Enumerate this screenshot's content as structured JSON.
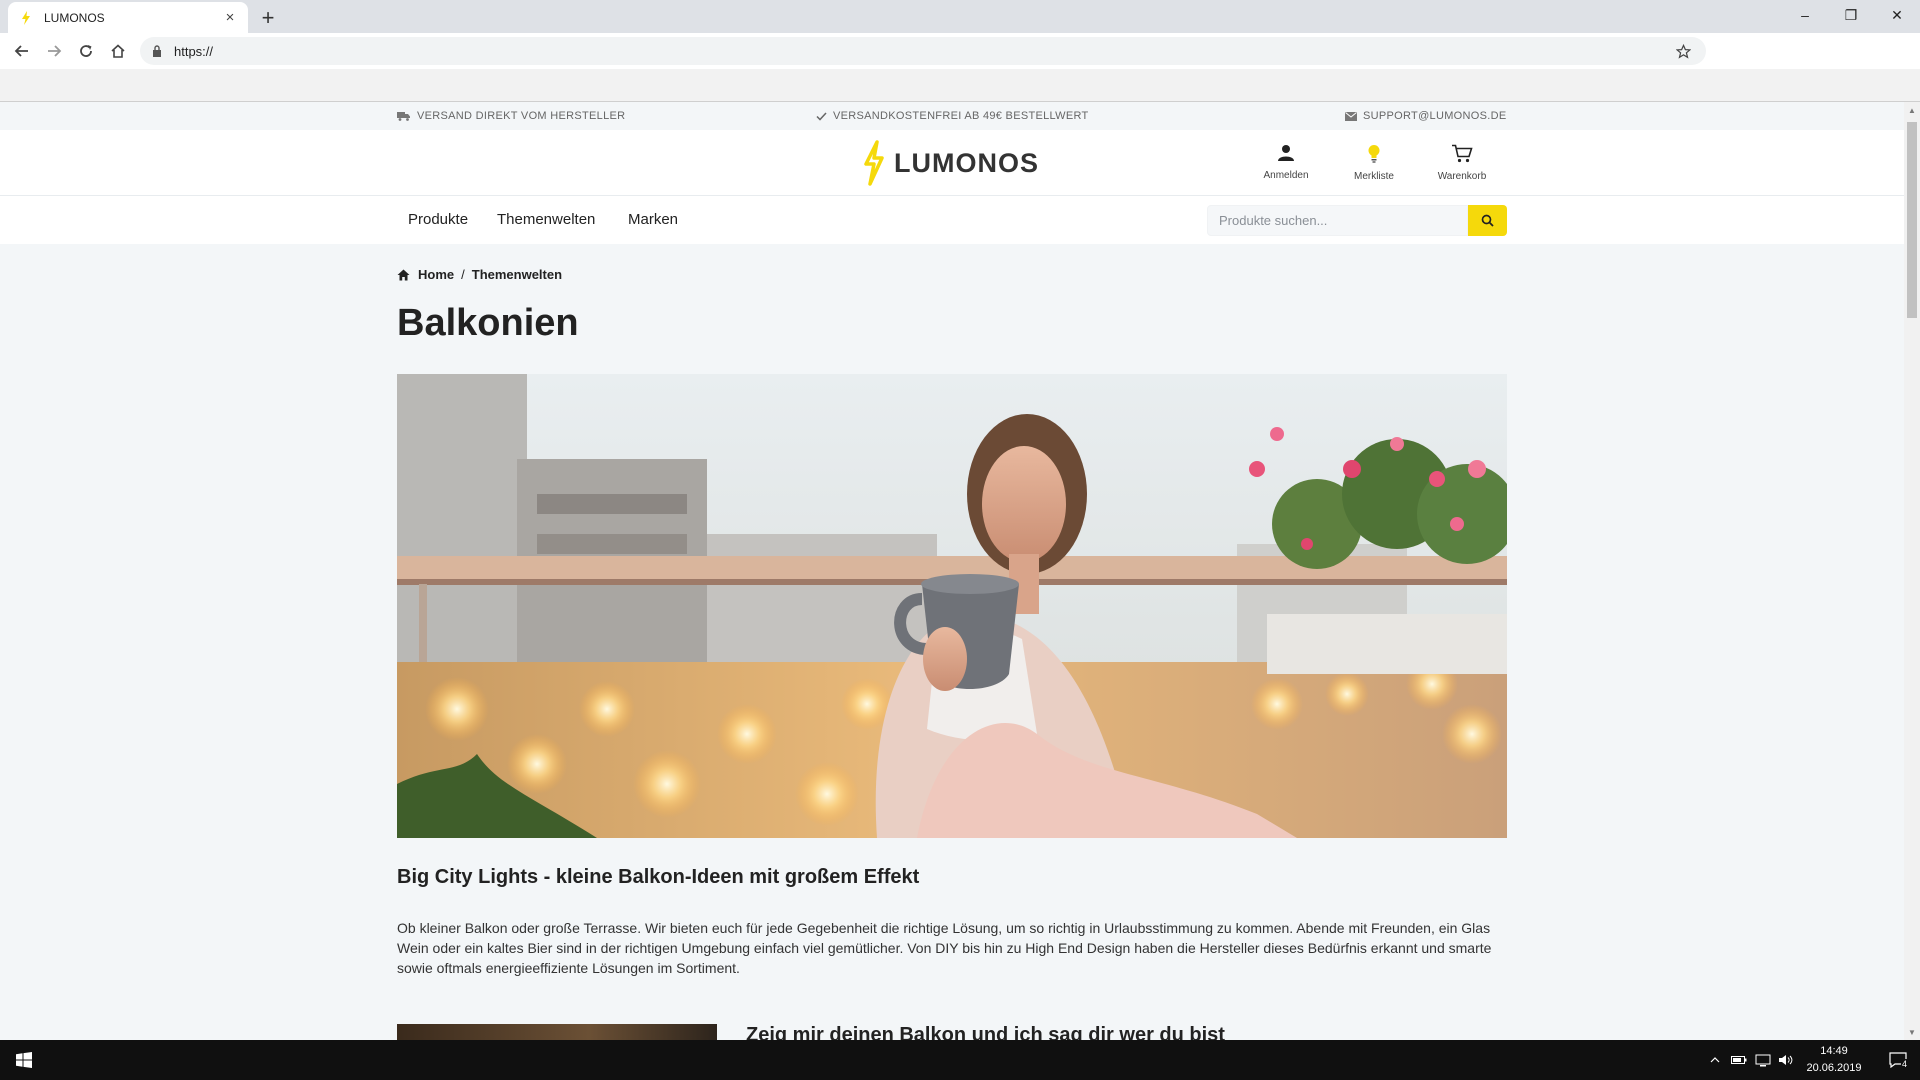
{
  "browser": {
    "tab_title": "LUMONOS",
    "tab_close": "×",
    "new_tab": "+",
    "url": "https://",
    "window_minimize": "–",
    "window_restore": "❐",
    "window_close": "✕"
  },
  "topbar": {
    "shipping": "VERSAND DIREKT VOM HERSTELLER",
    "free_shipping": "VERSANDKOSTENFREI AB 49€ BESTELLWERT",
    "support": "SUPPORT@LUMONOS.DE"
  },
  "header": {
    "logo_text": "LUMONOS",
    "login": "Anmelden",
    "wishlist": "Merkliste",
    "cart": "Warenkorb"
  },
  "nav": {
    "items": [
      "Produkte",
      "Themenwelten",
      "Marken"
    ],
    "search_placeholder": "Produkte suchen..."
  },
  "breadcrumb": {
    "home": "Home",
    "separator": "/",
    "current": "Themenwelten"
  },
  "page": {
    "title": "Balkonien",
    "subtitle": "Big City Lights - kleine Balkon-Ideen mit großem Effekt",
    "lead": "Ob kleiner Balkon oder große Terrasse. Wir bieten euch für jede Gegebenheit die richtige Lösung, um so richtig in Urlaubsstimmung zu kommen. Abende mit Freunden, ein Glas Wein oder ein kaltes Bier sind in der richtigen Umgebung einfach viel gemütlicher. Von DIY bis hin zu High End Design haben die Hersteller dieses Bedürfnis erkannt und smarte sowie oftmals energieeffiziente Lösungen im Sortiment.",
    "teaser_heading": "Zeig mir deinen Balkon und ich sag dir wer du bist"
  },
  "taskbar": {
    "time": "14:49",
    "date": "20.06.2019",
    "notification_count": "4"
  },
  "colors": {
    "accent": "#f5d90b",
    "text": "#222222",
    "page_bg": "#f3f6f8"
  }
}
